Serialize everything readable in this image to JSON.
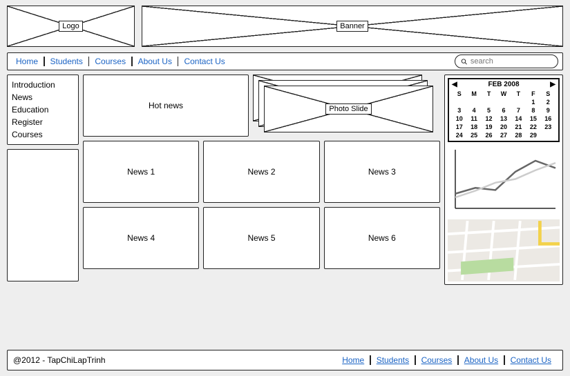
{
  "header": {
    "logo_label": "Logo",
    "banner_label": "Banner"
  },
  "nav": {
    "items": [
      "Home",
      "Students",
      "Courses",
      "About Us",
      "Contact Us"
    ],
    "search_placeholder": "search"
  },
  "sidebar": {
    "items": [
      "Introduction",
      "News",
      "Education",
      "Register",
      "Courses"
    ]
  },
  "content": {
    "hot_news_label": "Hot news",
    "photo_slide_label": "Photo Slide",
    "news_cards": [
      "News 1",
      "News 2",
      "News 3",
      "News 4",
      "News 5",
      "News 6"
    ]
  },
  "calendar": {
    "title": "FEB 2008",
    "dow": [
      "S",
      "M",
      "T",
      "W",
      "T",
      "F",
      "S"
    ],
    "days": [
      "",
      "",
      "",
      "",
      "",
      "1",
      "2",
      "3",
      "4",
      "5",
      "6",
      "7",
      "8",
      "9",
      "10",
      "11",
      "12",
      "13",
      "14",
      "15",
      "16",
      "17",
      "18",
      "19",
      "20",
      "21",
      "22",
      "23",
      "24",
      "25",
      "26",
      "27",
      "28",
      "29"
    ]
  },
  "footer": {
    "copyright": "@2012 - TapChiLapTrinh",
    "links": [
      "Home",
      "Students",
      "Courses",
      "About Us",
      "Contact Us"
    ]
  },
  "chart_data": {
    "type": "line",
    "x": [
      0,
      1,
      2,
      3,
      4,
      5
    ],
    "series": [
      {
        "name": "dark",
        "values": [
          20,
          28,
          25,
          50,
          65,
          55
        ],
        "color": "#666"
      },
      {
        "name": "light",
        "values": [
          15,
          24,
          35,
          40,
          52,
          62
        ],
        "color": "#ccc"
      }
    ],
    "xlim": [
      0,
      5
    ],
    "ylim": [
      0,
      80
    ]
  }
}
